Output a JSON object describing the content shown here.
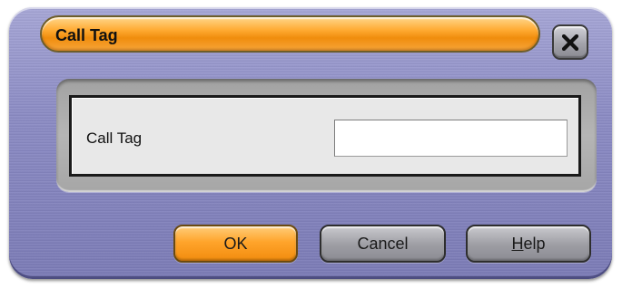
{
  "window": {
    "title": "Call Tag",
    "close_icon": "close-x-icon"
  },
  "form": {
    "call_tag_label": "Call Tag",
    "call_tag_value": ""
  },
  "buttons": {
    "ok_label": "OK",
    "cancel_label": "Cancel",
    "help_mnemonic": "H",
    "help_rest": "elp"
  },
  "colors": {
    "dialog_frame": "#8b8bc4",
    "title_bar": "#ffab33",
    "ok_button": "#ffa42b",
    "secondary_button": "#9d9da3",
    "panel_background": "#e8e8e8"
  }
}
